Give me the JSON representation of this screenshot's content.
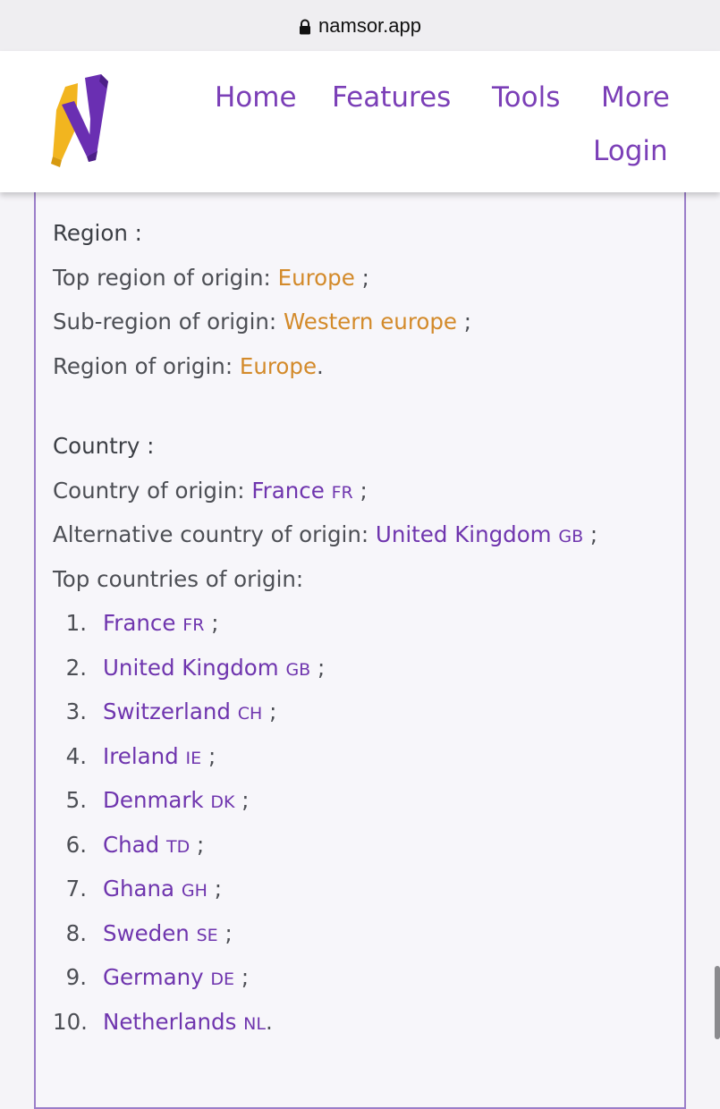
{
  "browser": {
    "url": "namsor.app"
  },
  "nav": {
    "home": "Home",
    "features": "Features",
    "tools": "Tools",
    "more": "More",
    "login": "Login"
  },
  "colors": {
    "accent_purple": "#6f35ae",
    "accent_orange": "#d38a2a",
    "logo_yellow": "#f2b51f",
    "logo_purple": "#6a2fb2"
  },
  "region": {
    "heading": "Region :",
    "top_region_label": "Top region of origin:",
    "top_region_value": "Europe",
    "top_region_suffix": ";",
    "sub_region_label": "Sub-region of origin:",
    "sub_region_value": "Western europe",
    "sub_region_suffix": ";",
    "region_label": "Region of origin:",
    "region_value": "Europe",
    "region_suffix": "."
  },
  "country": {
    "heading": "Country :",
    "origin_label": "Country of origin:",
    "origin_value": "France",
    "origin_code": "FR",
    "origin_suffix": ";",
    "alt_label": "Alternative country of origin:",
    "alt_value": "United Kingdom",
    "alt_code": "GB",
    "alt_suffix": ";",
    "top_label": "Top countries of origin:",
    "top_list": [
      {
        "num": "1.",
        "name": "France",
        "code": "FR",
        "suffix": ";"
      },
      {
        "num": "2.",
        "name": "United Kingdom",
        "code": "GB",
        "suffix": ";"
      },
      {
        "num": "3.",
        "name": "Switzerland",
        "code": "CH",
        "suffix": ";"
      },
      {
        "num": "4.",
        "name": "Ireland",
        "code": "IE",
        "suffix": ";"
      },
      {
        "num": "5.",
        "name": "Denmark",
        "code": "DK",
        "suffix": ";"
      },
      {
        "num": "6.",
        "name": "Chad",
        "code": "TD",
        "suffix": ";"
      },
      {
        "num": "7.",
        "name": "Ghana",
        "code": "GH",
        "suffix": ";"
      },
      {
        "num": "8.",
        "name": "Sweden",
        "code": "SE",
        "suffix": ";"
      },
      {
        "num": "9.",
        "name": "Germany",
        "code": "DE",
        "suffix": ";"
      },
      {
        "num": "10.",
        "name": "Netherlands",
        "code": "NL",
        "suffix": "."
      }
    ]
  }
}
